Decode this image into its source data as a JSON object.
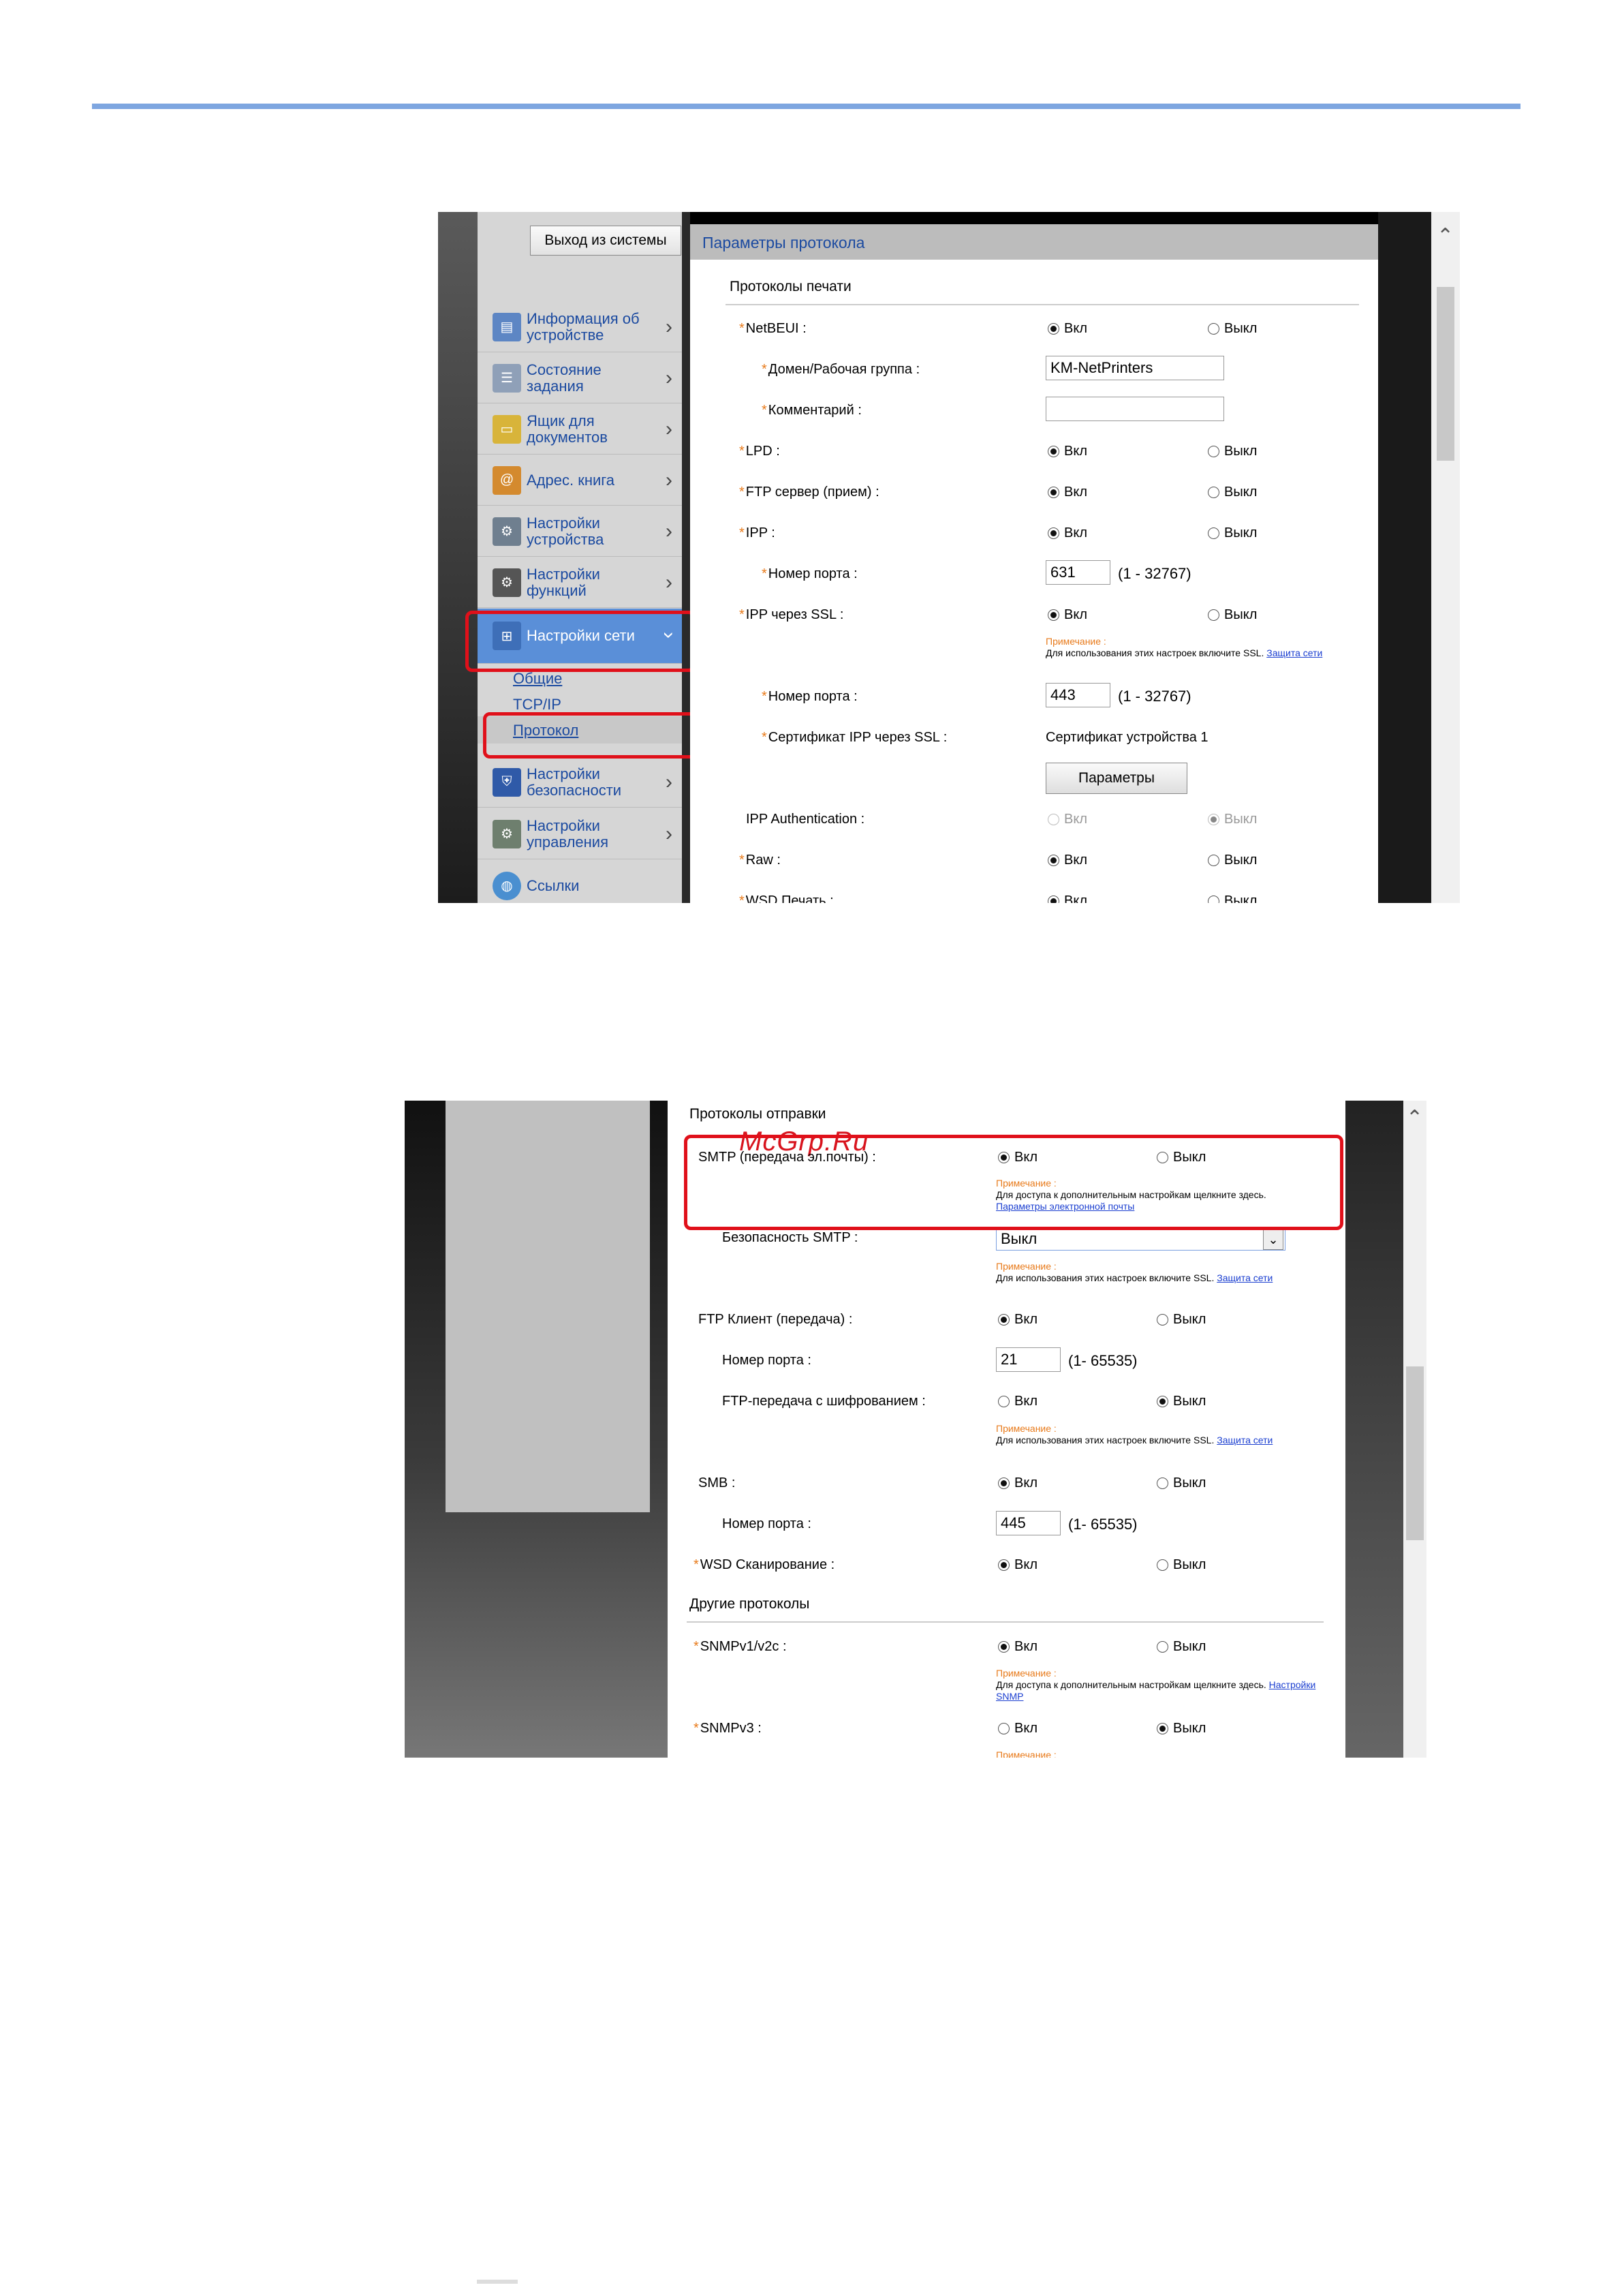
{
  "shot1": {
    "logout": "Выход из системы",
    "menu": [
      {
        "label": "Информация об устройстве",
        "icon": "device-info-icon"
      },
      {
        "label": "Состояние задания",
        "icon": "job-status-icon"
      },
      {
        "label": "Ящик для документов",
        "icon": "document-box-icon"
      },
      {
        "label": "Адрес. книга",
        "icon": "address-book-icon"
      },
      {
        "label": "Настройки устройства",
        "icon": "device-settings-icon"
      },
      {
        "label": "Настройки функций",
        "icon": "function-settings-icon"
      },
      {
        "label": "Настройки сети",
        "icon": "network-settings-icon"
      },
      {
        "label": "Настройки безопасности",
        "icon": "security-settings-icon"
      },
      {
        "label": "Настройки управления",
        "icon": "management-settings-icon"
      },
      {
        "label": "Ссылки",
        "icon": "links-icon"
      }
    ],
    "submenu": {
      "general": "Общие",
      "tcpip": "TCP/IP",
      "protocol": "Протокол"
    },
    "panel_title": "Параметры протокола",
    "section_print": "Протоколы печати",
    "on": "Вкл",
    "off": "Выкл",
    "rows": {
      "netbeui": "NetBEUI :",
      "domain": "Домен/Рабочая группа :",
      "domain_value": "KM-NetPrinters",
      "comment": "Комментарий :",
      "lpd": "LPD :",
      "ftp_server": "FTP сервер (прием) :",
      "ipp": "IPP :",
      "port_label": "Номер порта :",
      "ipp_port": "631",
      "ipp_range": "(1 - 32767)",
      "ipp_ssl": "IPP через SSL :",
      "note_head": "Примечание :",
      "note_ssl": "Для использования этих настроек включите SSL.",
      "note_ssl_link": "Защита сети",
      "ssl_port": "443",
      "ssl_range": "(1 - 32767)",
      "cert_label": "Сертификат IPP через SSL :",
      "cert_value": "Сертификат устройства 1",
      "params_button": "Параметры",
      "ipp_auth": "IPP Authentication :",
      "raw": "Raw :",
      "wsd_print": "WSD Печать :"
    }
  },
  "shot2": {
    "section_send": "Протоколы отправки",
    "watermark": "McGrp.Ru",
    "on": "Вкл",
    "off": "Выкл",
    "smtp": "SMTP (передача эл.почты) :",
    "note_head": "Примечание :",
    "note_more": "Для доступа к дополнительным настройкам щелкните здесь.",
    "email_link": "Параметры электронной почты",
    "smtp_security": "Безопасность SMTP :",
    "smtp_security_value": "Выкл",
    "note_ssl": "Для использования этих настроек включите SSL.",
    "note_ssl_link": "Защита сети",
    "ftp_client": "FTP Клиент (передача) :",
    "port_label": "Номер порта :",
    "ftp_port": "21",
    "ftp_range": "(1- 65535)",
    "ftp_enc": "FTP-передача с шифрованием :",
    "smb": "SMB :",
    "smb_port": "445",
    "smb_range": "(1- 65535)",
    "wsd_scan": "WSD Сканирование :",
    "section_other": "Другие протоколы",
    "snmpv1": "SNMPv1/v2c :",
    "snmp_link": "Настройки SNMP",
    "snmpv3": "SNMPv3 :",
    "note_cut": "Примечание :"
  }
}
